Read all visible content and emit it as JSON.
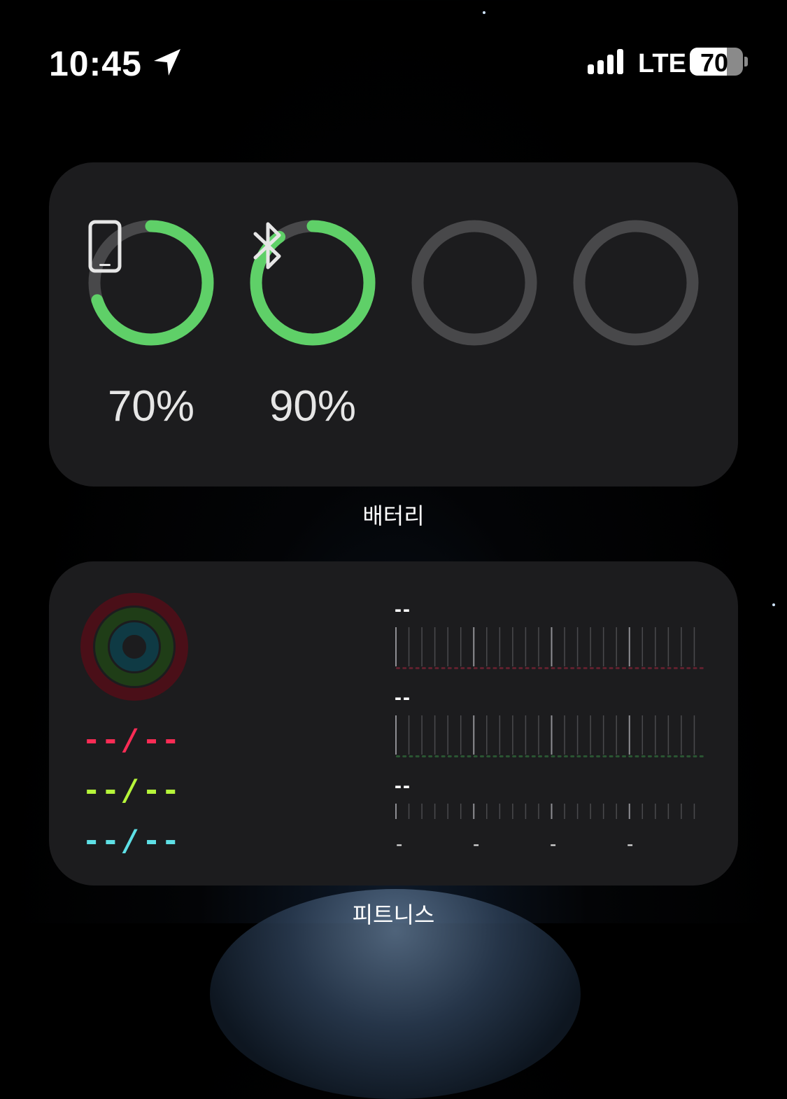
{
  "status_bar": {
    "time": "10:45",
    "network": "LTE",
    "battery_percent": "70",
    "battery_level": 0.7
  },
  "battery_widget": {
    "caption": "배터리",
    "devices": [
      {
        "name": "phone-icon",
        "level": 0.7,
        "label": "70%",
        "color": "#5fd068"
      },
      {
        "name": "bluetooth-icon",
        "level": 0.9,
        "label": "90%",
        "color": "#5fd068"
      },
      {
        "name": "empty",
        "level": 0,
        "label": ""
      },
      {
        "name": "empty",
        "level": 0,
        "label": ""
      }
    ],
    "track_color": "#48484a"
  },
  "fitness_widget": {
    "caption": "피트니스",
    "goals": [
      {
        "text_a": "--",
        "slash": "/",
        "text_b": "--",
        "color": "#fa2c55"
      },
      {
        "text_a": "--",
        "slash": "/",
        "text_b": "--",
        "color": "#b6f53a"
      },
      {
        "text_a": "--",
        "slash": "/",
        "text_b": "--",
        "color": "#5ee0e6"
      }
    ],
    "metrics": [
      {
        "label": "--",
        "color": "#ff2d55"
      },
      {
        "label": "--",
        "color": "#4cd964"
      },
      {
        "label": "--",
        "color": "#5ac8fa"
      }
    ],
    "time_ticks": [
      "-",
      "-",
      "-",
      "-"
    ]
  }
}
